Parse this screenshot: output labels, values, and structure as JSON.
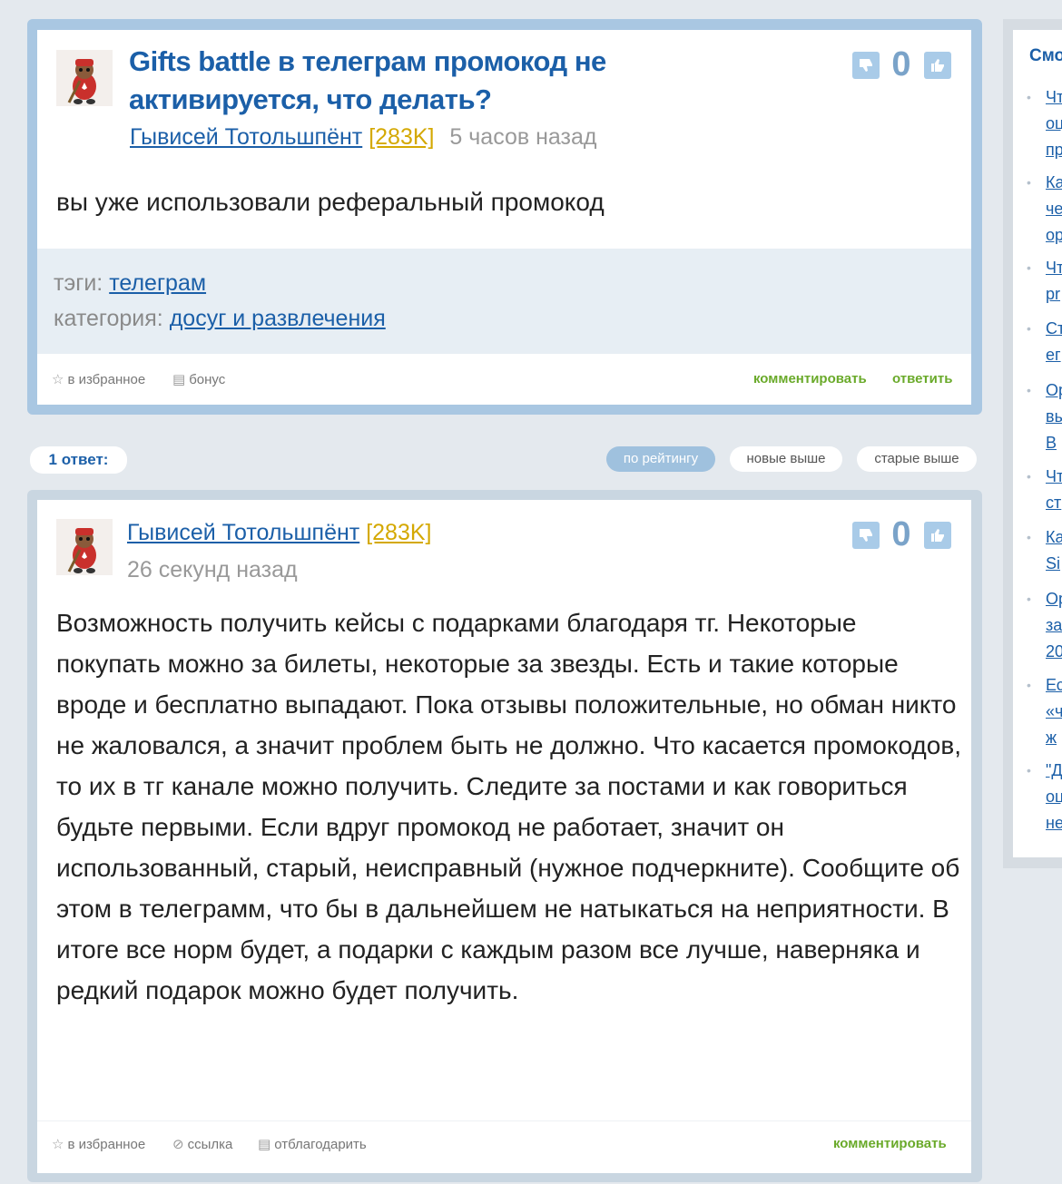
{
  "question": {
    "title": "Gifts battle в телеграм промокод не активируется, что делать?",
    "author": "Гывисей Тотольшпёнт",
    "rank": "[283K]",
    "time": "5 часов назад",
    "votes": "0",
    "text": "вы уже использовали реферальный промокод",
    "tags_label": "тэги:",
    "tag": "телеграм",
    "category_label": "категория:",
    "category": "досуг и развлечения",
    "footer": {
      "favorite": "в избранное",
      "bonus": "бонус",
      "comment": "комментировать",
      "answer": "ответить"
    }
  },
  "answers_bar": {
    "count": "1 ответ:",
    "sort": [
      "по рейтингу",
      "новые выше",
      "старые выше"
    ]
  },
  "answer": {
    "author": "Гывисей Тотольшпёнт",
    "rank": "[283K]",
    "time": "26 секунд назад",
    "votes": "0",
    "text": "Возможность получить кейсы с подарками благодаря тг. Некоторые покупать можно за билеты, некоторые за звезды. Есть и такие которые вроде и бесплатно выпадают. Пока отзывы положительные, но обман никто не жаловался, а значит проблем быть не должно. Что касается промокодов, то их в тг канале можно получить. Следите за постами и как говориться будьте первыми. Если вдруг промокод не работает, значит он использованный, старый, неисправный (нужное подчеркните). Сообщите об этом в телеграмм, что бы в дальнейшем не натыкаться на неприятности. В итоге все норм будет, а подарки с каждым разом все лучше, наверняка и редкий подарок можно будет получить.",
    "footer": {
      "favorite": "в избранное",
      "link": "ссылка",
      "thank": "отблагодарить",
      "comment": "комментировать"
    }
  },
  "sidebar": {
    "title": "Смо",
    "items": [
      [
        "Чт",
        "оц",
        "пр"
      ],
      [
        "Ка",
        "че",
        "ор"
      ],
      [
        "Чт",
        "pr"
      ],
      [
        "Ст",
        "ег"
      ],
      [
        "Ор",
        "вы",
        "В"
      ],
      [
        "Чт",
        "ст"
      ],
      [
        "Ка",
        "Si"
      ],
      [
        "Ор",
        "за",
        "20"
      ],
      [
        "Ес",
        "«ч",
        "ж"
      ],
      [
        "\"Д",
        "оц",
        "не"
      ]
    ]
  }
}
